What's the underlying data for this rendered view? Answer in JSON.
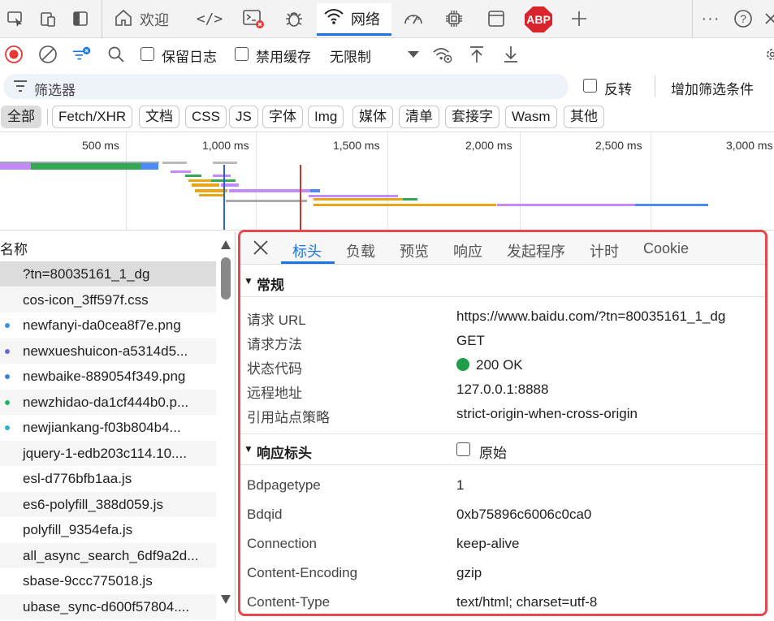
{
  "tabbar": {
    "welcome_label": "欢迎",
    "network_label": "网络",
    "abp_label": "ABP",
    "icons": [
      "inspect-icon",
      "device-icon",
      "dock-icon",
      "home-icon",
      "elements-icon",
      "console-icon",
      "bug-icon",
      "wifi-icon",
      "performance-icon",
      "memory-icon",
      "application-icon",
      "adblock-icon",
      "add-icon",
      "more-icon",
      "help-icon",
      "close-icon"
    ]
  },
  "toolbar": {
    "preserve_log": "保留日志",
    "disable_cache": "禁用缓存",
    "throttling": "无限制"
  },
  "filter": {
    "placeholder": "筛选器",
    "invert": "反转",
    "more_filters": "增加筛选条件"
  },
  "type_filters": [
    "全部",
    "Fetch/XHR",
    "文档",
    "CSS",
    "JS",
    "字体",
    "Img",
    "媒体",
    "清单",
    "套接字",
    "Wasm",
    "其他"
  ],
  "overview": {
    "ticks": [
      "500 ms",
      "1,000 ms",
      "1,500 ms",
      "2,000 ms",
      "2,500 ms",
      "3,000 ms"
    ]
  },
  "request_list": {
    "header": "名称",
    "rows": [
      {
        "name": "?tn=80035161_1_dg",
        "dot": ""
      },
      {
        "name": "cos-icon_3ff597f.css",
        "dot": ""
      },
      {
        "name": "newfanyi-da0cea8f7e.png",
        "dot": "#3b8fe0"
      },
      {
        "name": "newxueshuicon-a5314d5...",
        "dot": "#6a6ad8"
      },
      {
        "name": "newbaike-889054f349.png",
        "dot": "#4a7bd8"
      },
      {
        "name": "newzhidao-da1cf444b0.p...",
        "dot": "#22b36a"
      },
      {
        "name": "newjiankang-f03b804b4...",
        "dot": "#2bb5c9"
      },
      {
        "name": "jquery-1-edb203c114.10....",
        "dot": ""
      },
      {
        "name": "esl-d776bfb1aa.js",
        "dot": ""
      },
      {
        "name": "es6-polyfill_388d059.js",
        "dot": ""
      },
      {
        "name": "polyfill_9354efa.js",
        "dot": ""
      },
      {
        "name": "all_async_search_6df9a2d...",
        "dot": ""
      },
      {
        "name": "sbase-9ccc775018.js",
        "dot": ""
      },
      {
        "name": "ubase_sync-d600f57804....",
        "dot": ""
      }
    ]
  },
  "detail": {
    "tabs": [
      "标头",
      "负载",
      "预览",
      "响应",
      "发起程序",
      "计时",
      "Cookie"
    ],
    "general_title": "常规",
    "general": [
      {
        "label": "请求 URL",
        "value": "https://www.baidu.com/?tn=80035161_1_dg"
      },
      {
        "label": "请求方法",
        "value": "GET"
      },
      {
        "label": "状态代码",
        "value": "200 OK"
      },
      {
        "label": "远程地址",
        "value": "127.0.0.1:8888"
      },
      {
        "label": "引用站点策略",
        "value": "strict-origin-when-cross-origin"
      }
    ],
    "response_headers_title": "响应标头",
    "raw_label": "原始",
    "response_headers": [
      {
        "label": "Bdpagetype",
        "value": "1"
      },
      {
        "label": "Bdqid",
        "value": "0xb75896c6006c0ca0"
      },
      {
        "label": "Connection",
        "value": "keep-alive"
      },
      {
        "label": "Content-Encoding",
        "value": "gzip"
      },
      {
        "label": "Content-Type",
        "value": "text/html; charset=utf-8"
      }
    ]
  },
  "colors": {
    "accent": "#1a73e8",
    "record_red": "#e53935",
    "highlight_border": "#e8474e",
    "status_ok": "#1e9e48"
  }
}
